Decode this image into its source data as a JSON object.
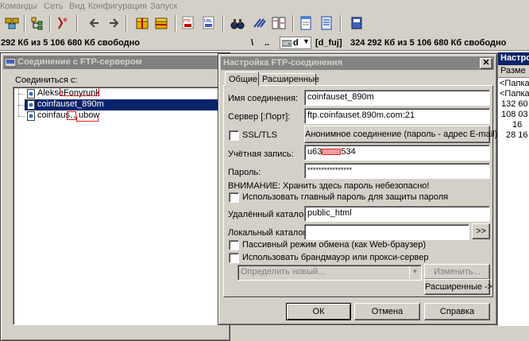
{
  "menu": [
    "Команды",
    "Сеть",
    "Вид",
    "Конфигурация",
    "Запуск"
  ],
  "drivebar": {
    "left_free": "292 Кб из 5 106 680 Кб свободно",
    "backslash": "\\",
    "dots": "..",
    "drive": "d",
    "drive_label": "[d_fuj]",
    "right_free": "324 292 Кб из 5 106 680 Кб свободно"
  },
  "right_panel": {
    "title": "Настро",
    "col_header": "Разме",
    "rows": [
      "<Папка",
      "<Папка",
      "132 60",
      "108 03",
      "16",
      "28 16"
    ]
  },
  "conn_window": {
    "title": "Соединение с FTP-сервером",
    "connect_label": "Соединиться с:",
    "items": [
      "AlekseFonyrunk",
      "coinfauset_890m",
      "coinfaus…ubow"
    ]
  },
  "settings": {
    "title": "Настройка FTP-соединения",
    "tabs": [
      "Общие",
      "Расширенные"
    ],
    "conn_name_label": "Имя соединения:",
    "conn_name": "coinfauset_890m",
    "server_label": "Сервер [:Порт]:",
    "server": "ftp.coinfauset.890m.com:21",
    "ssl_label": "SSL/TLS",
    "anon_button": "Анонимное соединение (пароль - адрес E-mail)",
    "account_label": "Учётная запись:",
    "account_prefix": "u63",
    "account_suffix": "534",
    "password_label": "Пароль:",
    "password_mask": "****************",
    "warning": "ВНИМАНИЕ: Хранить здесь пароль небезопасно!",
    "master_pwd_label": "Использовать главный пароль для защиты пароля",
    "remote_dir_label": "Удалённый каталог:",
    "remote_dir": "public_html",
    "local_dir_label": "Локальный каталог:",
    "local_dir": "",
    "browse_button": ">>",
    "passive_label": "Пассивный режим обмена (как Web-браузер)",
    "firewall_label": "Использовать брандмауэр или прокси-сервер",
    "define_placeholder": "Определить новый...",
    "change_button": "Изменить...",
    "advanced_button": "Расширенные ->",
    "ok": "ОК",
    "cancel": "Отмена",
    "help": "Справка"
  },
  "colors": {
    "selection": "#0a246a",
    "face": "#d4d0c8",
    "inactive_title": "#808080",
    "redact": "#e02020"
  }
}
